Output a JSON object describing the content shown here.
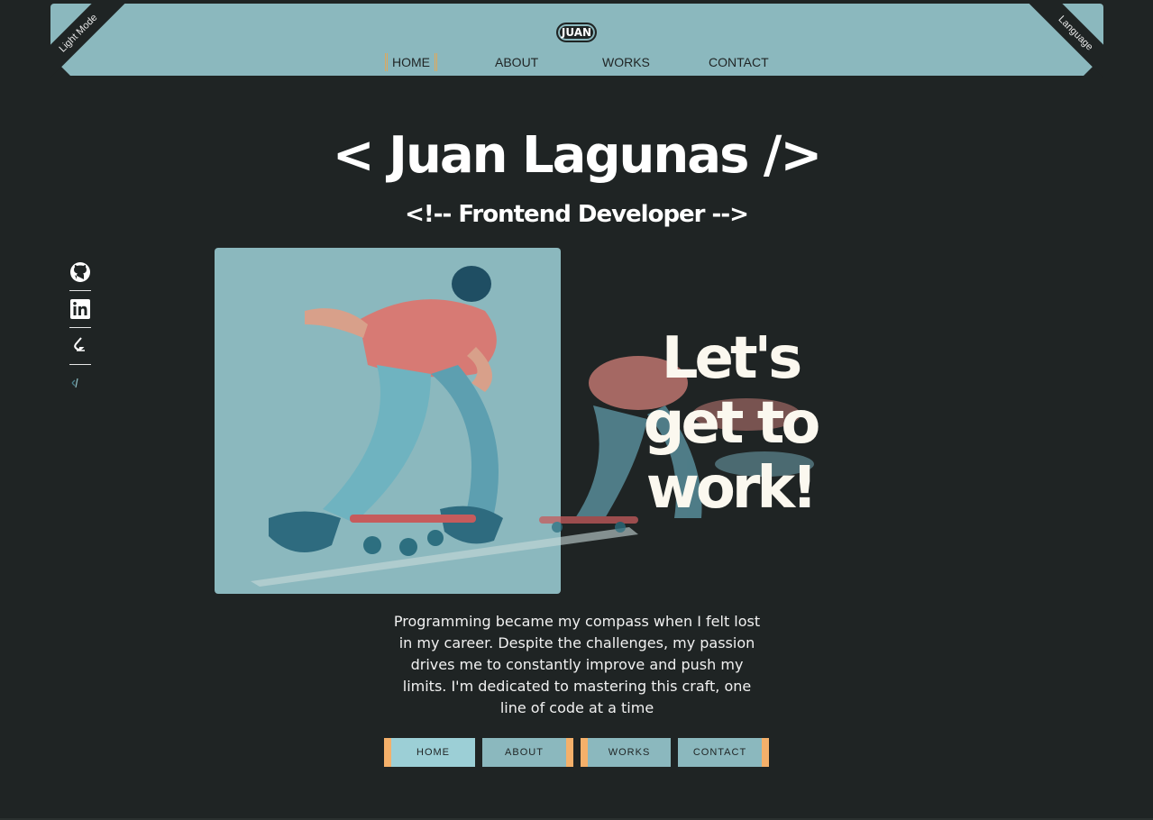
{
  "header": {
    "logo": "JUAN",
    "corner_left": "Light Mode",
    "corner_right": "Language",
    "nav": [
      "HOME",
      "ABOUT",
      "WORKS",
      "CONTACT"
    ],
    "active_nav": "HOME"
  },
  "hero": {
    "title": "< Juan  Lagunas />",
    "subtitle": "<!-- Frontend Developer -->",
    "slogan": [
      "Let's",
      "get to",
      "work!"
    ]
  },
  "social": [
    "github-icon",
    "linkedin-icon",
    "codewars-icon",
    "js-icon"
  ],
  "description": "Programming became my compass when I felt lost in my career. Despite the challenges, my passion drives me to constantly improve and push my limits. I'm dedicated to mastering this craft, one line of code at a time",
  "buttons": [
    "HOME",
    "ABOUT",
    "WORKS",
    "CONTACT"
  ],
  "colors": {
    "background": "#1f2424",
    "banner": "#8bb8be",
    "accent": "#f4b06a",
    "text": "#ffffff"
  }
}
